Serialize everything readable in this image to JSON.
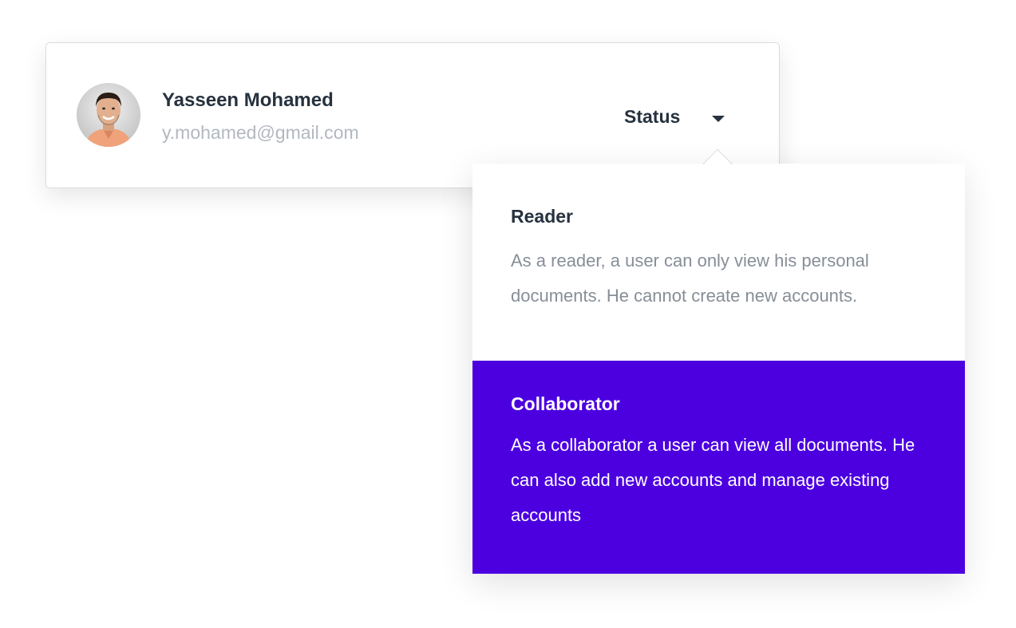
{
  "user": {
    "name": "Yasseen Mohamed",
    "email": "y.mohamed@gmail.com",
    "avatar_icon": "user-avatar-photo"
  },
  "status": {
    "label": "Status",
    "icon": "chevron-down-icon"
  },
  "options": [
    {
      "title": "Reader",
      "description": "As a reader, a user can only view his personal documents. He cannot create new accounts.",
      "selected": false
    },
    {
      "title": "Collaborator",
      "description": "As a collaborator a user can view all documents. He can also add new accounts and manage existing accounts",
      "selected": true
    }
  ],
  "colors": {
    "accent": "#4c00e0",
    "text_dark": "#26323f",
    "text_muted": "#878e97",
    "email": "#b3b8bf",
    "border": "#d9dbde"
  }
}
